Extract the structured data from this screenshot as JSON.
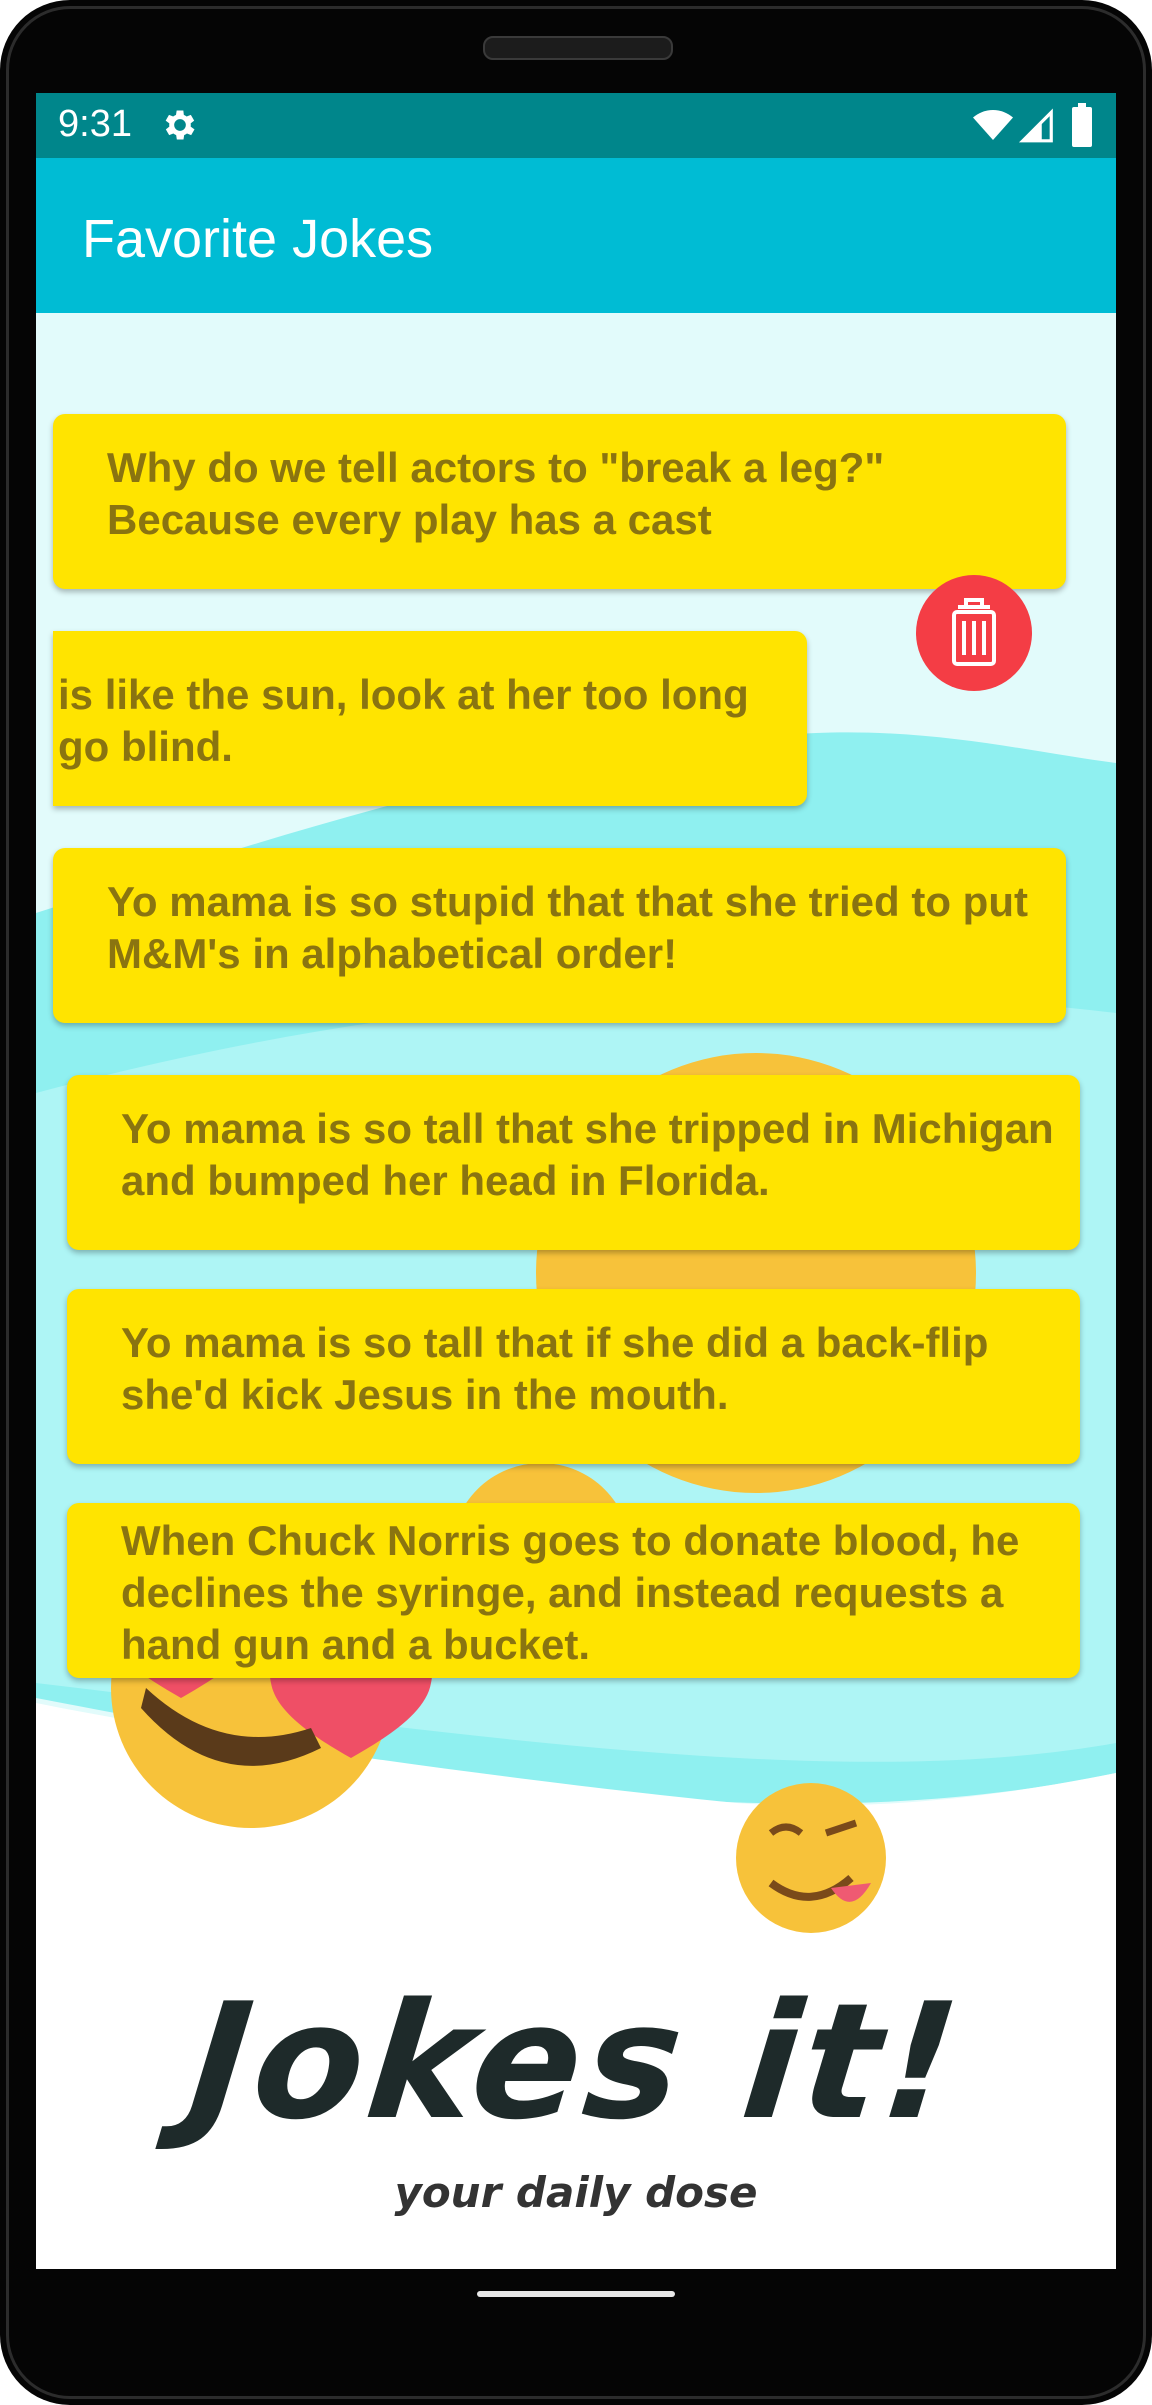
{
  "status_bar": {
    "time": "9:31",
    "icons": [
      "settings-icon",
      "wifi-icon",
      "cell-signal-icon",
      "battery-icon"
    ]
  },
  "app_bar": {
    "title": "Favorite Jokes"
  },
  "jokes": [
    {
      "line1": "Why do we tell  actors to \"break a leg?\"",
      "line2": "Because every play has a cast"
    },
    {
      "line1": "is like the sun, look at her too long",
      "line2": "go blind.",
      "swiped": true
    },
    {
      "line1": "Yo mama is so stupid that that she tried to put",
      "line2": "M&M's in alphabetical order!"
    },
    {
      "line1": "Yo mama is so tall that she tripped in Michigan",
      "line2": "and bumped her head in Florida."
    },
    {
      "line1": "Yo mama is so tall that if she did a back-flip",
      "line2": "she'd kick Jesus in the mouth."
    },
    {
      "line1": "When Chuck Norris goes to donate blood, he",
      "line2": "declines the syringe, and instead requests a",
      "line3": "hand gun and a bucket."
    }
  ],
  "delete_action": {
    "icon": "trash-icon"
  },
  "background": {
    "brand": "Jokes it!",
    "tagline": "your daily dose"
  },
  "colors": {
    "status_bar": "#00868b",
    "app_bar": "#00bcd4",
    "card": "#ffe400",
    "card_text": "#8a7410",
    "delete_button": "#f43d45"
  }
}
